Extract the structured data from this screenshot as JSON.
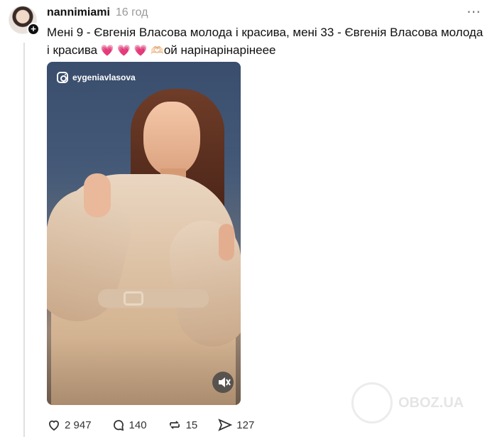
{
  "post": {
    "username": "nannimiami",
    "time": "16 год",
    "more_icon": "⋯",
    "avatar_add_icon": "+",
    "text": "Мені 9 - Євгенія Власова молода і красива, мені 33 - Євгенія Власова молода і красива ",
    "emoji_hearts": [
      "💗",
      "💗",
      "💗"
    ],
    "emoji_hands": "🫶🏻",
    "text_end": "ой нарінарінарінеее"
  },
  "media": {
    "instagram_handle": "eygeniavlasova",
    "mute_icon": "muted-speaker"
  },
  "actions": {
    "likes": "2 947",
    "comments": "140",
    "reposts": "15",
    "shares": "127"
  },
  "watermark": {
    "text": "OBOZ.UA"
  }
}
